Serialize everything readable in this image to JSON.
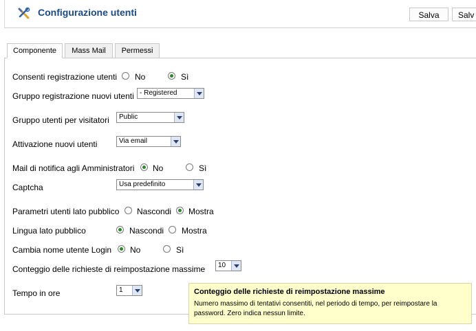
{
  "header": {
    "title": "Configurazione utenti",
    "icon": "tools-icon",
    "buttons": [
      "Salva",
      "Salv"
    ]
  },
  "tabs": [
    "Componente",
    "Mass Mail",
    "Permessi"
  ],
  "form": {
    "consenti_registrazione": {
      "label": "Consenti registrazione utenti",
      "opt1": "No",
      "opt2": "Sì",
      "selected": "Sì"
    },
    "gruppo_registrazione": {
      "label": "Gruppo registrazione nuovi utenti",
      "value": "- Registered"
    },
    "gruppo_visitatori": {
      "label": "Gruppo utenti per visitatori",
      "value": "Public"
    },
    "attivazione": {
      "label": "Attivazione nuovi utenti",
      "value": "Via email"
    },
    "mail_notifica": {
      "label": "Mail di notifica agli Amministratori",
      "opt1": "No",
      "opt2": "Sì",
      "selected": "No"
    },
    "captcha": {
      "label": "Captcha",
      "value": "Usa predefinito"
    },
    "parametri_pubblico": {
      "label": "Parametri utenti lato pubblico",
      "opt1": "Nascondi",
      "opt2": "Mostra",
      "selected": "Mostra"
    },
    "lingua_pubblico": {
      "label": "Lingua lato pubblico",
      "opt1": "Nascondi",
      "opt2": "Mostra",
      "selected": "Nascondi"
    },
    "cambia_nome": {
      "label": "Cambia nome utente Login",
      "opt1": "No",
      "opt2": "Sì",
      "selected": "No"
    },
    "conteggio": {
      "label": "Conteggio delle richieste di reimpostazione massime",
      "value": "10"
    },
    "tempo": {
      "label": "Tempo in ore",
      "value": "1"
    }
  },
  "tooltip": {
    "title": "Conteggio delle richieste di reimpostazione massime",
    "body": "Numero massimo di tentativi consentiti, nel periodo di tempo, per reimpostare la password. Zero indica nessun limite."
  }
}
